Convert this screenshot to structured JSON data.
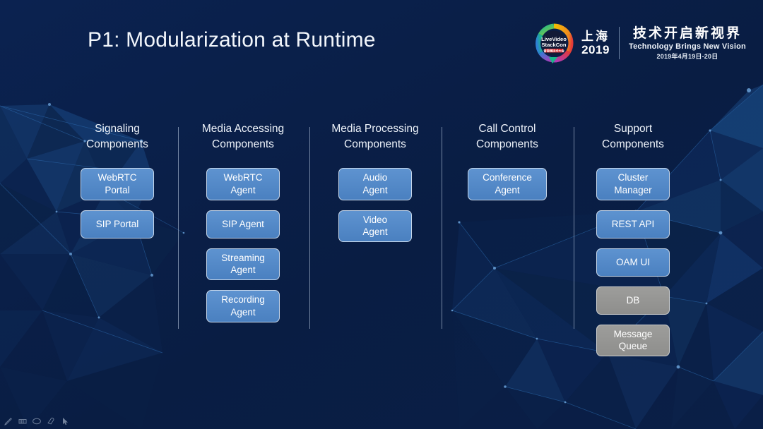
{
  "slide": {
    "title": "P1: Modularization at Runtime",
    "background_color": "#0a2049",
    "box_color": "#5089c9",
    "box_grey_color": "#979795"
  },
  "logo": {
    "mark_name": "livevideostackcon-logo",
    "mark_text_line1": "LiveVideo",
    "mark_text_line2": "StackCon",
    "mark_text_line3": "音视频技术大会",
    "city_cn": "上海",
    "year": "2019",
    "tagline_cn": "技术开启新视界",
    "tagline_en": "Technology Brings New Vision",
    "date": "2019年4月19日-20日"
  },
  "columns": [
    {
      "title": "Signaling\nComponents",
      "boxes": [
        {
          "label": "WebRTC\nPortal",
          "style": "blue"
        },
        {
          "label": "SIP Portal",
          "style": "blue"
        }
      ]
    },
    {
      "title": "Media Accessing\nComponents",
      "boxes": [
        {
          "label": "WebRTC\nAgent",
          "style": "blue"
        },
        {
          "label": "SIP Agent",
          "style": "blue"
        },
        {
          "label": "Streaming\nAgent",
          "style": "blue"
        },
        {
          "label": "Recording\nAgent",
          "style": "blue"
        }
      ]
    },
    {
      "title": "Media Processing\nComponents",
      "boxes": [
        {
          "label": "Audio\nAgent",
          "style": "blue"
        },
        {
          "label": "Video\nAgent",
          "style": "blue"
        }
      ]
    },
    {
      "title": "Call Control\nComponents",
      "boxes": [
        {
          "label": "Conference\nAgent",
          "style": "blue"
        }
      ]
    },
    {
      "title": "Support\nComponents",
      "boxes": [
        {
          "label": "Cluster\nManager",
          "style": "blue"
        },
        {
          "label": "REST API",
          "style": "blue"
        },
        {
          "label": "OAM UI",
          "style": "blue"
        },
        {
          "label": "DB",
          "style": "grey"
        },
        {
          "label": "Message\nQueue",
          "style": "grey"
        }
      ]
    }
  ],
  "toolbar": {
    "items": [
      {
        "icon": "pen-icon"
      },
      {
        "icon": "highlighter-icon"
      },
      {
        "icon": "ellipse-icon"
      },
      {
        "icon": "eraser-icon"
      },
      {
        "icon": "cursor-arrow-icon"
      }
    ]
  }
}
